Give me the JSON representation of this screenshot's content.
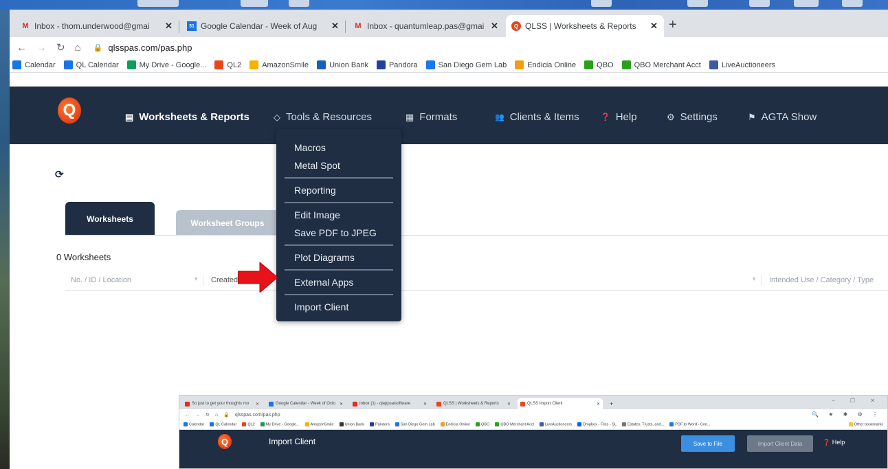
{
  "browser": {
    "tabs": [
      {
        "title": "Inbox - thom.underwood@gmai",
        "icon": "gmail-icon",
        "color": "#d93025",
        "glyph": "M"
      },
      {
        "title": "Google Calendar - Week of Aug",
        "icon": "calendar-icon",
        "color": "#1a73e8",
        "glyph": "31"
      },
      {
        "title": "Inbox - quantumleap.pas@gmai",
        "icon": "gmail-icon",
        "color": "#d93025",
        "glyph": "M"
      },
      {
        "title": "QLSS | Worksheets & Reports",
        "icon": "qlss-icon",
        "color": "#e8471c",
        "glyph": "Q"
      }
    ],
    "url": "qlsspas.com/pas.php",
    "bookmarks": [
      {
        "label": "Calendar",
        "color": "#1a73e8"
      },
      {
        "label": "QL Calendar",
        "color": "#1a73e8"
      },
      {
        "label": "My Drive - Google...",
        "color": "#0f9d58"
      },
      {
        "label": "QL2",
        "color": "#e8471c"
      },
      {
        "label": "AmazonSmile",
        "color": "#f4b400"
      },
      {
        "label": "Union Bank",
        "color": "#1560bd"
      },
      {
        "label": "Pandora",
        "color": "#224099"
      },
      {
        "label": "San Diego Gem Lab",
        "color": "#1877f2"
      },
      {
        "label": "Endicia Online",
        "color": "#f29d12"
      },
      {
        "label": "QBO",
        "color": "#2ca01c"
      },
      {
        "label": "QBO Merchant Acct",
        "color": "#2ca01c"
      },
      {
        "label": "LiveAuctioneers",
        "color": "#3b5ba5"
      }
    ]
  },
  "nav": {
    "items": [
      {
        "label": "Worksheets & Reports",
        "icon": "▤"
      },
      {
        "label": "Tools & Resources",
        "icon": "◇"
      },
      {
        "label": "Formats",
        "icon": "▦"
      },
      {
        "label": "Clients & Items",
        "icon": "👥"
      },
      {
        "label": "Help",
        "icon": "❓"
      },
      {
        "label": "Settings",
        "icon": "⚙"
      },
      {
        "label": "AGTA Show",
        "icon": "⚑"
      }
    ]
  },
  "dropdown": {
    "groups": [
      [
        "Macros",
        "Metal Spot"
      ],
      [
        "Reporting"
      ],
      [
        "Edit Image",
        "Save PDF to JPEG"
      ],
      [
        "Plot Diagrams"
      ],
      [
        "External Apps"
      ],
      [
        "Import Client"
      ]
    ]
  },
  "content": {
    "tabs": [
      "Worksheets",
      "Worksheet Groups"
    ],
    "count_label": "0 Worksheets",
    "columns": [
      "No. / ID / Location",
      "Created",
      "Intended Use / Category / Type"
    ]
  },
  "inset": {
    "tabs": [
      {
        "title": "So just to get your thoughts mo",
        "color": "#d93025"
      },
      {
        "title": "Google Calendar - Week of Octo",
        "color": "#1a73e8"
      },
      {
        "title": "Inbox (1) - qlappsaisoftware",
        "color": "#d93025"
      },
      {
        "title": "QLSS | Worksheets & Reports",
        "color": "#e8471c"
      },
      {
        "title": "QLSS Import Client",
        "color": "#e8471c"
      }
    ],
    "url": "qlsspas.com/pas.php",
    "bookmarks": [
      "Calendar",
      "QL Calendar",
      "QL2",
      "My Drive - Google...",
      "AmazonSmile",
      "Union Bank",
      "Pandora",
      "San Diego Gem Lab",
      "Endicia Online",
      "QBO",
      "QBO Merchant Acct",
      "LiveAuctioneers",
      "Dropbox - Files - SL",
      "Estates, Trusts, and...",
      "PDF to Word - Con..."
    ],
    "other_bookmarks": "Other bookmarks",
    "page_title": "Import Client",
    "save_button": "Save to File",
    "import_button": "Import Client Data",
    "help_label": "Help"
  },
  "colors": {
    "nav_bg": "#1f2e43",
    "accent": "#3b8fe0",
    "arrow": "#e8121a"
  }
}
